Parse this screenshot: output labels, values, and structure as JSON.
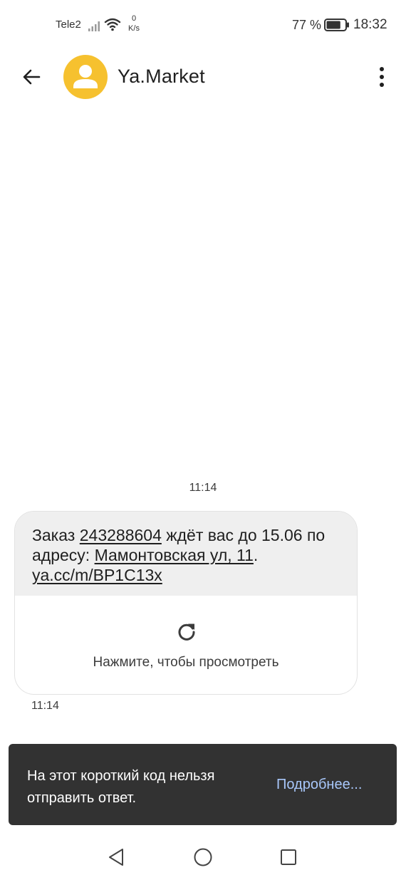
{
  "status_bar": {
    "carrier": "Tele2",
    "netspeed_value": "0",
    "netspeed_unit": "K/s",
    "battery_percent": "77 %",
    "battery_level": 0.77,
    "time": "18:32",
    "icons": [
      "signal-icon",
      "wifi-icon",
      "battery-icon"
    ]
  },
  "app_bar": {
    "contact_name": "Ya.Market",
    "icons": [
      "arrow-back-icon",
      "person-icon",
      "more-vert-icon"
    ],
    "avatar_color": "#f6c12f"
  },
  "conversation": {
    "time_header": "11:14",
    "message": {
      "part1": "Заказ ",
      "order_number": "243288604",
      "part2": " ждёт вас до 15.06 по адресу: ",
      "address": "Мамонтовская ул, 11",
      "part3": ". ",
      "short_link": "ya.cc/m/BP1C13x"
    },
    "preview": {
      "icon": "refresh-icon",
      "label": "Нажмите, чтобы просмотреть"
    },
    "time_footer": "11:14"
  },
  "snackbar": {
    "text": "На этот короткий код нельзя отправить ответ.",
    "action": "Подробнее..."
  },
  "nav_bar": {
    "icons": [
      "nav-back-icon",
      "nav-home-icon",
      "nav-recent-icon"
    ]
  }
}
